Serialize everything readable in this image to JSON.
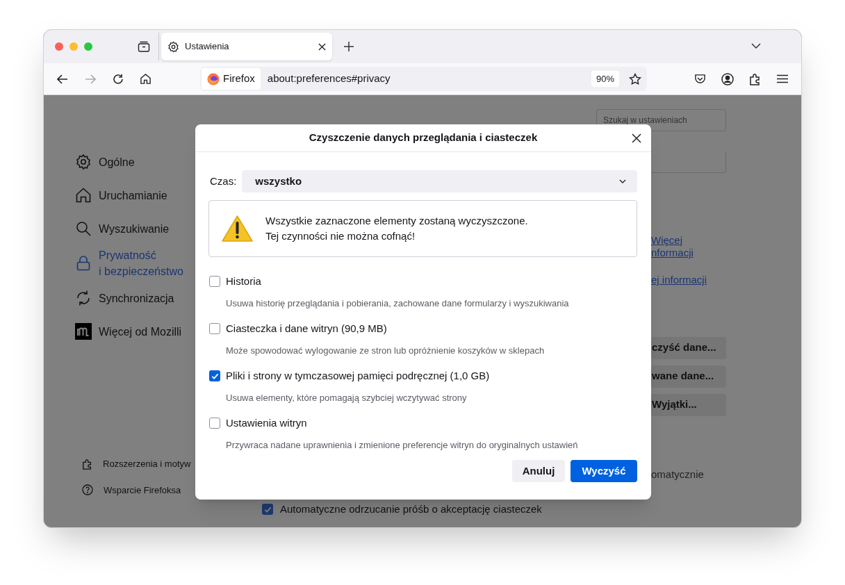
{
  "browser": {
    "tab": {
      "title": "Ustawienia"
    },
    "identity": "Firefox",
    "url": "about:preferences#privacy",
    "zoom": "90%"
  },
  "sidebar": {
    "items": [
      {
        "label": "Ogólne",
        "selected": false
      },
      {
        "label": "Uruchamianie",
        "selected": false
      },
      {
        "label": "Wyszukiwanie",
        "selected": false
      },
      {
        "label": "Prywatność i bezpieczeństwo",
        "selected": true
      },
      {
        "label": "Synchronizacja",
        "selected": false
      },
      {
        "label": "Więcej od Mozilli",
        "selected": false
      }
    ],
    "footer": [
      "Rozszerzenia i motyw",
      "Wsparcie Firefoksa"
    ]
  },
  "page": {
    "search": {
      "placeholder": "Szukaj w ustawieniach"
    },
    "links": [
      "Więcej nformacji",
      "ej informacji"
    ],
    "buttons": [
      "czyść dane...",
      "wane dane...",
      "Wyjątki..."
    ],
    "partial_text": "omatycznie",
    "auto_reject": {
      "label": "Automatyczne odrzucanie próśb o akceptację ciasteczek",
      "checked": true
    }
  },
  "dialog": {
    "title": "Czyszczenie danych przeglądania i ciasteczek",
    "time_label": "Czas:",
    "time_value": "wszystko",
    "warning": [
      "Wszystkie zaznaczone elementy zostaną wyczyszczone.",
      "Tej czynności nie można cofnąć!"
    ],
    "options": [
      {
        "label": "Historia",
        "description": "Usuwa historię przeglądania i pobierania, zachowane dane formularzy i wyszukiwania",
        "checked": false
      },
      {
        "label": "Ciasteczka i dane witryn (90,9 MB)",
        "description": "Może spowodować wylogowanie ze stron lub opróżnienie koszyków w sklepach",
        "checked": false
      },
      {
        "label": "Pliki i strony w tymczasowej pamięci podręcznej (1,0 GB)",
        "description": "Usuwa elementy, które pomagają szybciej wczytywać strony",
        "checked": true
      },
      {
        "label": "Ustawienia witryn",
        "description": "Przywraca nadane uprawnienia i zmienione preferencje witryn do oryginalnych ustawień",
        "checked": false
      }
    ],
    "buttons": [
      {
        "label": "Anuluj",
        "kind": "secondary"
      },
      {
        "label": "Wyczyść",
        "kind": "primary"
      }
    ]
  }
}
